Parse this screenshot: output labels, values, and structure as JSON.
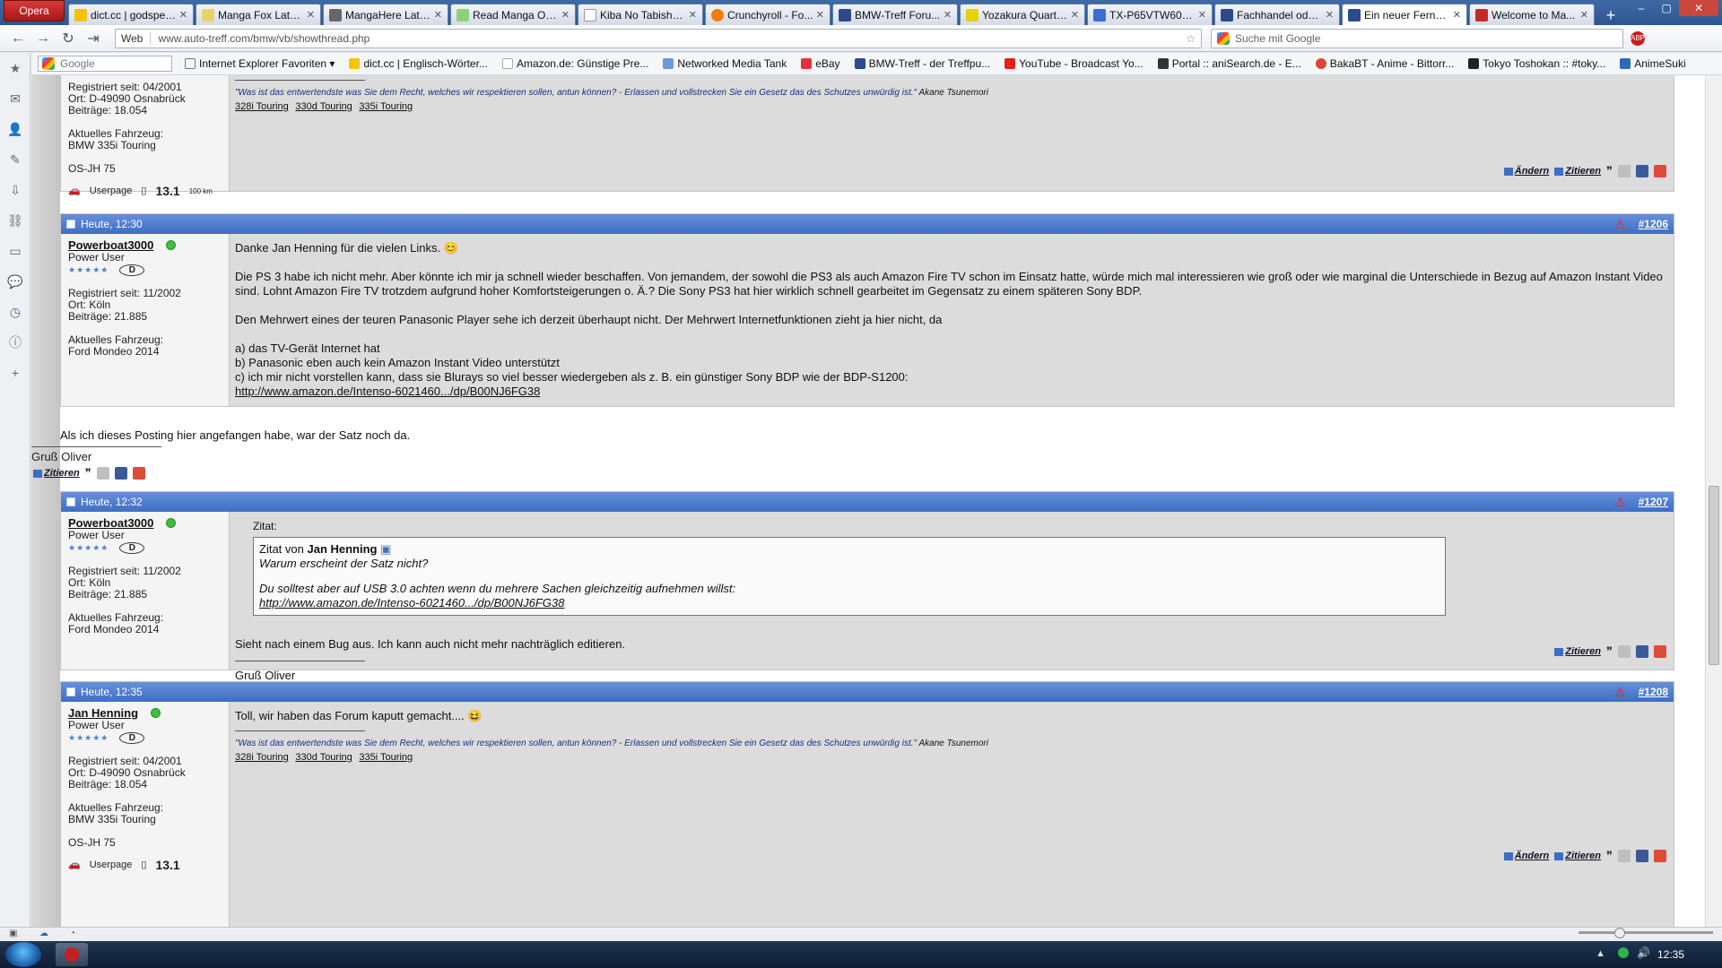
{
  "browser": {
    "menu_label": "Opera",
    "tabs": [
      {
        "label": "dict.cc | godspee...",
        "color": "#f5c400"
      },
      {
        "label": "Manga Fox Lates...",
        "color": "#e8d36a"
      },
      {
        "label": "MangaHere Late...",
        "color": "#666666"
      },
      {
        "label": "Read Manga Onl...",
        "color": "#8fd17a"
      },
      {
        "label": "Kiba No Tabisho...",
        "color": "#ffffff"
      },
      {
        "label": "Crunchyroll - Fo...",
        "color": "#f57c00"
      },
      {
        "label": "BMW-Treff Foru...",
        "color": "#2b4b8a"
      },
      {
        "label": "Yozakura Quarte...",
        "color": "#e6d200"
      },
      {
        "label": "TX-P65VTW60 u...",
        "color": "#3a6fd8"
      },
      {
        "label": "Fachhandel oder...",
        "color": "#2b4b8a"
      },
      {
        "label": "Ein neuer Fernse...",
        "color": "#2b4b8a"
      },
      {
        "label": "Welcome to Ma...",
        "color": "#c52a2a"
      }
    ],
    "address": {
      "web_label": "Web",
      "url": "www.auto-treff.com/bmw/vb/showthread.php"
    },
    "search_placeholder": "Suche mit Google",
    "bookmarks": {
      "search_placeholder": "Google",
      "items": [
        "Internet Explorer Favoriten",
        "dict.cc | Englisch-Wörter...",
        "Amazon.de: Günstige Pre...",
        "Networked Media Tank",
        "eBay",
        "BMW-Treff - der Treffpu...",
        "YouTube - Broadcast Yo...",
        "Portal :: aniSearch.de - E...",
        "BakaBT - Anime - Bittorr...",
        "Tokyo Toshokan :: #toky...",
        "AnimeSuki"
      ]
    }
  },
  "sidebar_icons": [
    "star-icon",
    "mail-icon",
    "contacts-icon",
    "notes-icon",
    "downloads-icon",
    "links-icon",
    "windows-icon",
    "chat-icon",
    "history-icon",
    "info-icon",
    "add-icon"
  ],
  "thread": {
    "post_top": {
      "registered": "Registriert seit: 04/2001",
      "location": "Ort: D-49090 Osnabrück",
      "posts": "Beiträge: 18.054",
      "vehicle_label": "Aktuelles Fahrzeug:",
      "vehicle": "BMW 335i Touring",
      "plate": "OS-JH 75",
      "userpage": "Userpage",
      "consumption": "13.1",
      "consumption_unit": "100 km",
      "sig_quote": "\"Was ist das entwertendste was Sie dem Recht, welches wir respektieren sollen, antun können? - Erlassen und vollstrecken Sie ein Gesetz das des Schutzes unwürdig ist.\"",
      "sig_author": "Akane Tsunemori",
      "sig_links": [
        "328i Touring",
        "330d Touring",
        "335i Touring"
      ],
      "edit": "Ändern",
      "quote": "Zitieren"
    },
    "post_1206": {
      "time": "Heute, 12:30",
      "number": "#1206",
      "user": "Powerboat3000",
      "rank": "Power User",
      "badge": "D",
      "registered": "Registriert seit: 11/2002",
      "location": "Ort: Köln",
      "posts": "Beiträge: 21.885",
      "vehicle_label": "Aktuelles Fahrzeug:",
      "vehicle": "Ford Mondeo 2014",
      "p1": "Danke Jan Henning für die vielen Links.",
      "p2": "Die PS 3 habe ich nicht mehr. Aber könnte ich mir ja schnell wieder beschaffen. Von jemandem, der sowohl die PS3 als auch Amazon Fire TV schon im Einsatz hatte, würde mich mal interessieren wie groß oder wie marginal die Unterschiede in Bezug auf Amazon Instant Video sind. Lohnt Amazon Fire TV trotzdem aufgrund hoher Komfortsteigerungen o. Ä.? Die Sony PS3 hat hier wirklich schnell gearbeitet im Gegensatz zu einem späteren Sony BDP.",
      "p3": "Den Mehrwert eines der teuren Panasonic Player sehe ich derzeit überhaupt nicht. Der Mehrwert Internetfunktionen zieht ja hier nicht, da",
      "l1": "a) das TV-Gerät Internet hat",
      "l2": "b) Panasonic eben auch kein Amazon Instant Video unterstützt",
      "l3": "c) ich mir nicht vorstellen kann, dass sie Blurays so viel besser wiedergeben als z. B. ein günstiger Sony BDP wie der BDP-S1200:",
      "link": "http://www.amazon.de/Intenso-6021460.../dp/B00NJ6FG38"
    },
    "orphan": {
      "text": "Als ich dieses Posting hier angefangen habe, war der Satz noch da.",
      "greeting": "Gruß Oliver",
      "quote": "Zitieren"
    },
    "post_1207": {
      "time": "Heute, 12:32",
      "number": "#1207",
      "user": "Powerboat3000",
      "rank": "Power User",
      "badge": "D",
      "registered": "Registriert seit: 11/2002",
      "location": "Ort: Köln",
      "posts": "Beiträge: 21.885",
      "vehicle_label": "Aktuelles Fahrzeug:",
      "vehicle": "Ford Mondeo 2014",
      "quote_label": "Zitat:",
      "quote_from": "Zitat von",
      "quote_user": "Jan Henning",
      "quote_l1": "Warum erscheint der Satz nicht?",
      "quote_l2": "Du solltest aber auf USB 3.0 achten wenn du mehrere Sachen gleichzeitig aufnehmen willst:",
      "quote_link": "http://www.amazon.de/Intenso-6021460.../dp/B00NJ6FG38",
      "text": "Sieht nach einem Bug aus. Ich kann auch nicht mehr nachträglich editieren.",
      "greeting": "Gruß Oliver",
      "quote": "Zitieren"
    },
    "post_1208": {
      "time": "Heute, 12:35",
      "number": "#1208",
      "user": "Jan Henning",
      "rank": "Power User",
      "badge": "D",
      "registered": "Registriert seit: 04/2001",
      "location": "Ort: D-49090 Osnabrück",
      "posts": "Beiträge: 18.054",
      "vehicle_label": "Aktuelles Fahrzeug:",
      "vehicle": "BMW 335i Touring",
      "plate": "OS-JH 75",
      "text": "Toll, wir haben das Forum kaputt gemacht....",
      "sig_quote": "\"Was ist das entwertendste was Sie dem Recht, welches wir respektieren sollen, antun können? - Erlassen und vollstrecken Sie ein Gesetz das des Schutzes unwürdig ist.\"",
      "sig_author": "Akane Tsunemori",
      "sig_links": [
        "328i Touring",
        "330d Touring",
        "335i Touring"
      ],
      "userpage": "Userpage",
      "consumption": "13.1",
      "edit": "Ändern",
      "quote": "Zitieren"
    }
  },
  "taskbar": {
    "clock": "12:35"
  }
}
